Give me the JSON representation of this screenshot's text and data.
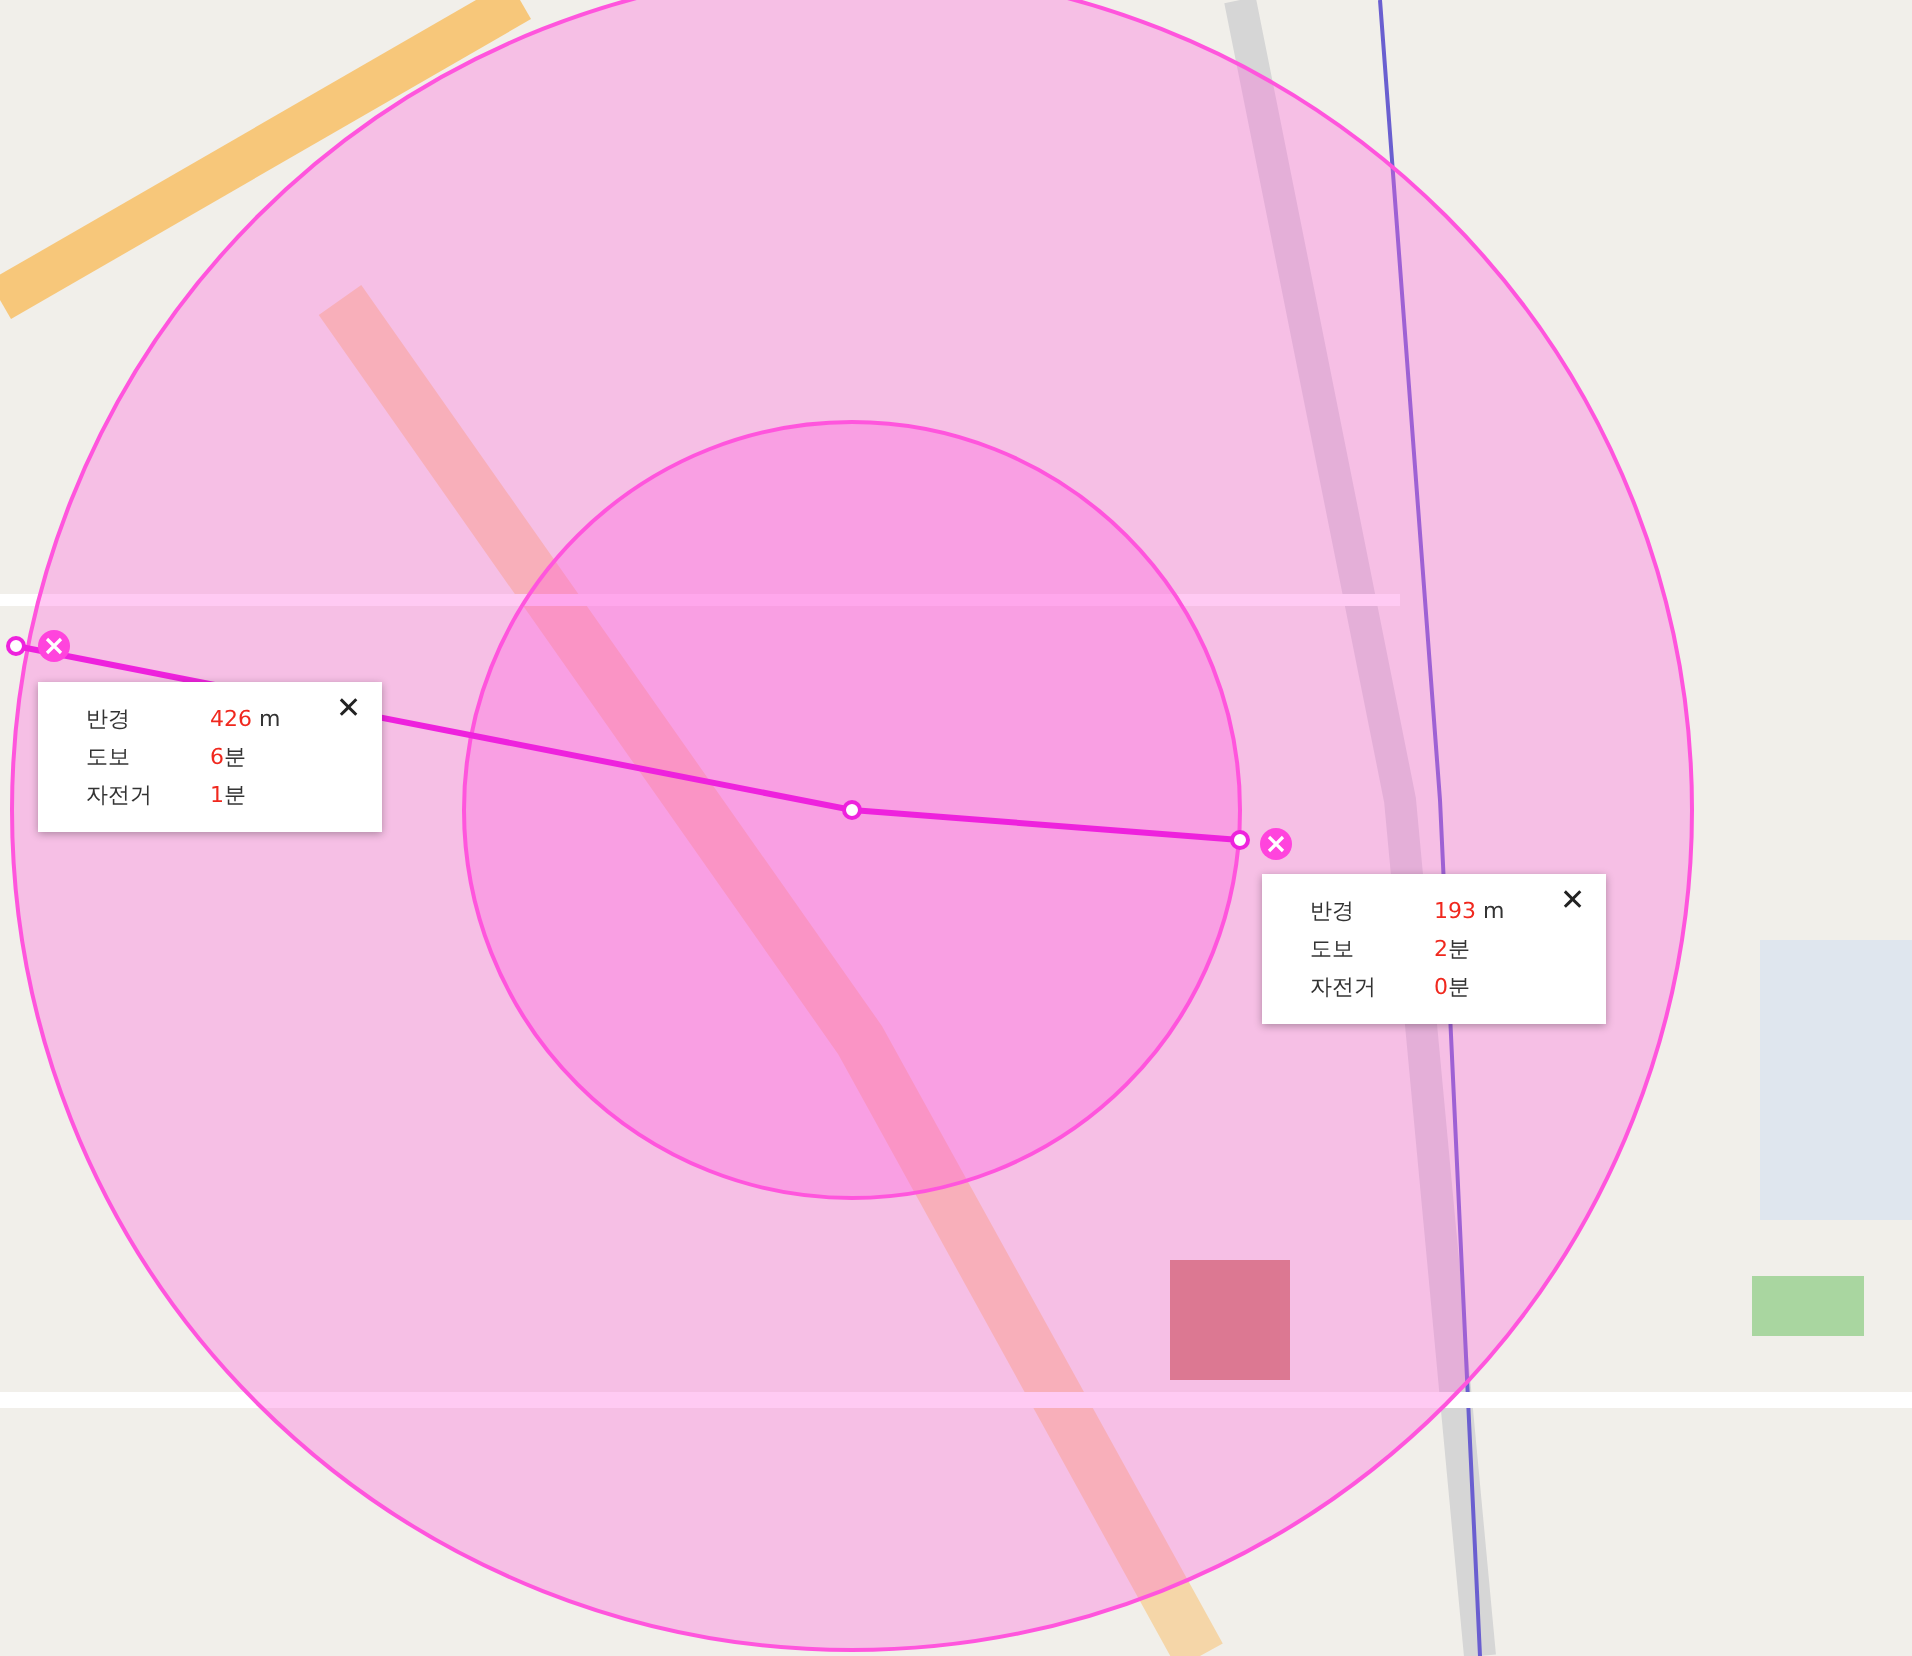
{
  "measurements": [
    {
      "rows": [
        {
          "label": "반경",
          "value": "426",
          "unit": "m"
        },
        {
          "label": "도보",
          "value": "6",
          "unit": "분"
        },
        {
          "label": "자전거",
          "value": "1",
          "unit": "분"
        }
      ],
      "close": "✕"
    },
    {
      "rows": [
        {
          "label": "반경",
          "value": "193",
          "unit": "m"
        },
        {
          "label": "도보",
          "value": "2",
          "unit": "분"
        },
        {
          "label": "자전거",
          "value": "0",
          "unit": "분"
        }
      ],
      "close": "✕"
    }
  ]
}
